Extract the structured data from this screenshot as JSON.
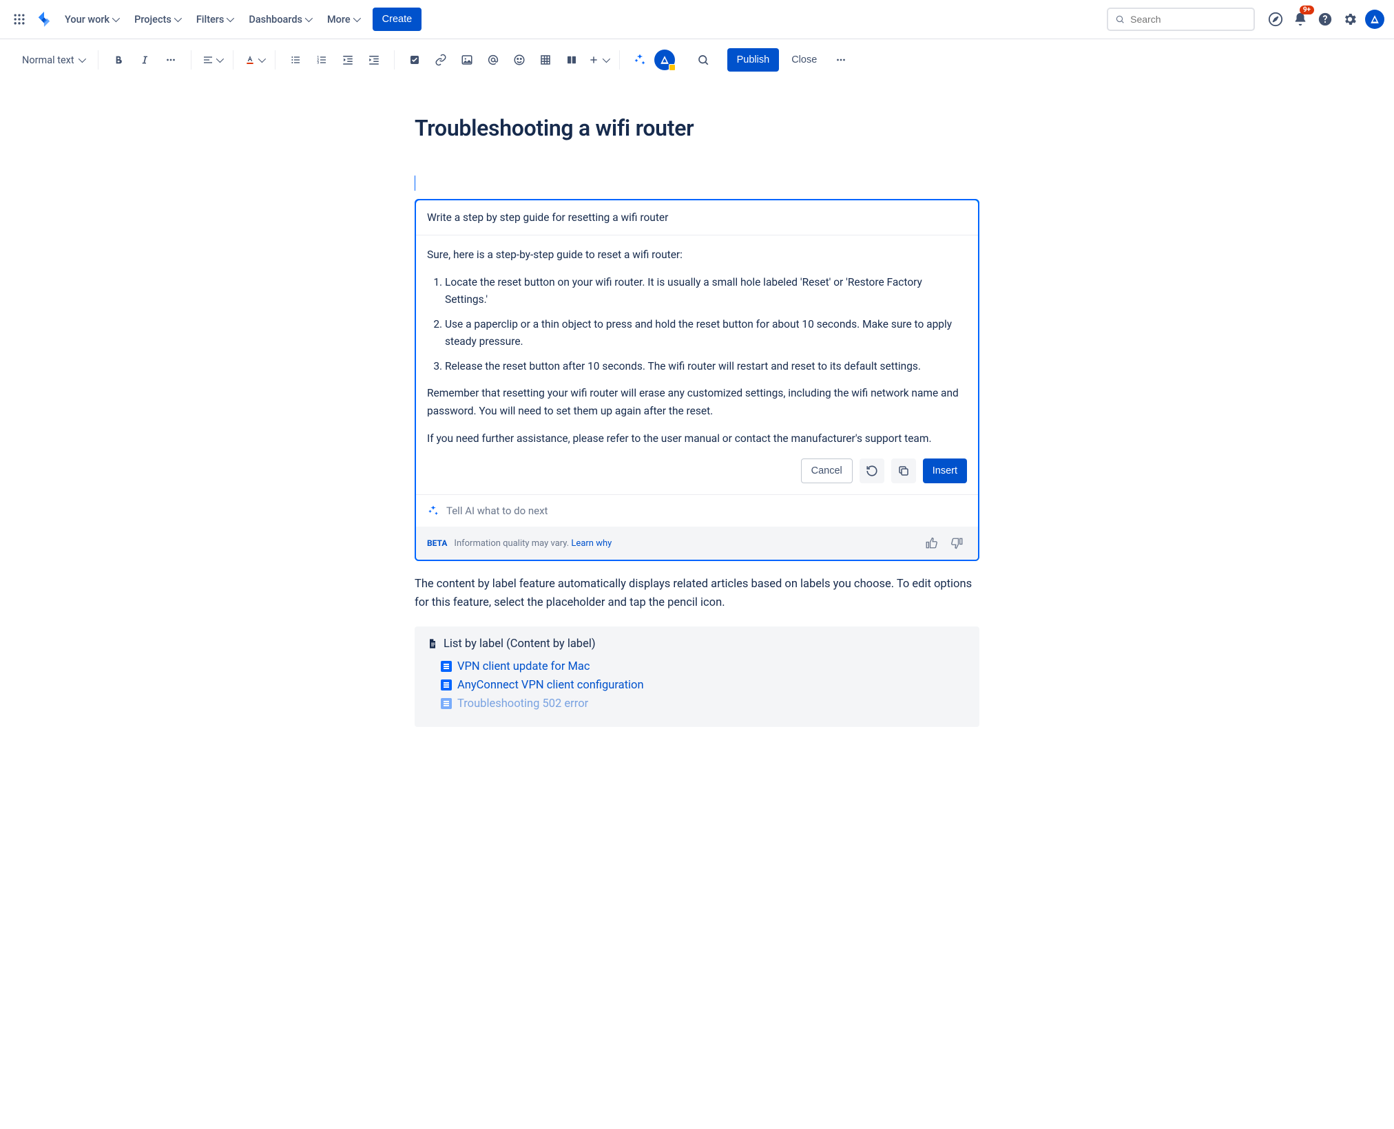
{
  "topnav": {
    "items": [
      "Your work",
      "Projects",
      "Filters",
      "Dashboards",
      "More"
    ],
    "create": "Create",
    "search_placeholder": "Search",
    "notif_badge": "9+"
  },
  "toolbar": {
    "text_style": "Normal text",
    "publish": "Publish",
    "close": "Close"
  },
  "document": {
    "title": "Troubleshooting a wifi router",
    "paragraph": "The content by label feature automatically displays related articles based on labels you choose. To edit options for this feature, select the placeholder and tap the pencil icon."
  },
  "ai": {
    "prompt": "Write a step by step guide for resetting a wifi router",
    "intro": "Sure, here is a step-by-step guide to reset a wifi router:",
    "steps": [
      "Locate the reset button on your wifi router. It is usually a small hole labeled 'Reset' or 'Restore Factory Settings.'",
      "Use a paperclip or a thin object to press and hold the reset button for about 10 seconds. Make sure to apply steady pressure.",
      "Release the reset button after 10 seconds. The wifi router will restart and reset to its default settings."
    ],
    "note1": "Remember that resetting your wifi router will erase any customized settings, including the wifi network name and password. You will need to set them up again after the reset.",
    "note2": "If you need further assistance, please refer to the user manual or contact the manufacturer's support team.",
    "cancel": "Cancel",
    "insert": "Insert",
    "next_placeholder": "Tell AI what to do next",
    "beta": "BETA",
    "disclaimer": "Information quality may vary.",
    "learn": "Learn why"
  },
  "macro": {
    "header": "List by label (Content by label)",
    "items": [
      "VPN client update for Mac",
      "AnyConnect VPN client configuration",
      "Troubleshooting 502 error"
    ]
  }
}
